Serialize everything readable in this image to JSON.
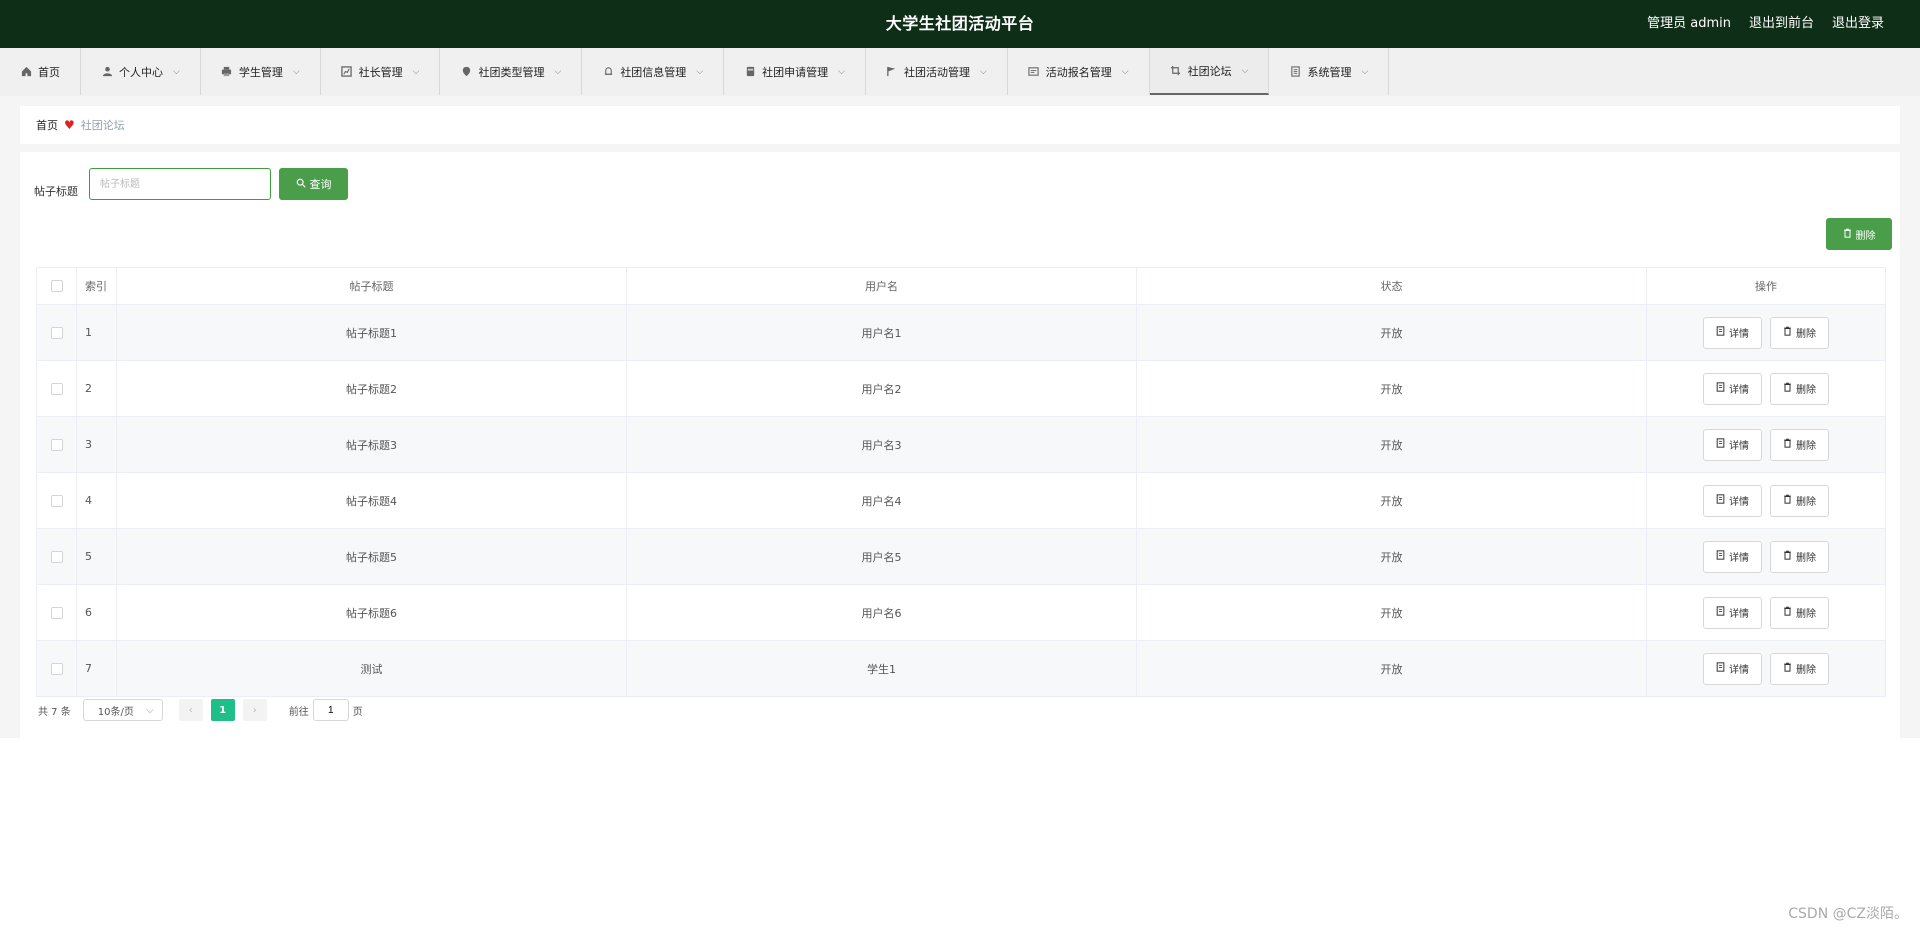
{
  "header": {
    "title": "大学生社团活动平台",
    "admin_label": "管理员 admin",
    "to_front_label": "退出到前台",
    "logout_label": "退出登录",
    "bg_color": "#0e2e18"
  },
  "nav": {
    "items": [
      {
        "label": "首页",
        "icon": "home-icon"
      },
      {
        "label": "个人中心",
        "icon": "user-icon"
      },
      {
        "label": "学生管理",
        "icon": "printer-icon"
      },
      {
        "label": "社长管理",
        "icon": "chart-icon"
      },
      {
        "label": "社团类型管理",
        "icon": "pin-icon"
      },
      {
        "label": "社团信息管理",
        "icon": "bell-icon"
      },
      {
        "label": "社团申请管理",
        "icon": "box-icon"
      },
      {
        "label": "社团活动管理",
        "icon": "flag-icon"
      },
      {
        "label": "活动报名管理",
        "icon": "card-icon"
      },
      {
        "label": "社团论坛",
        "icon": "crop-icon"
      },
      {
        "label": "系统管理",
        "icon": "list-icon"
      }
    ],
    "active_index": 9
  },
  "breadcrumb": {
    "home": "首页",
    "current": "社团论坛"
  },
  "search": {
    "label": "帖子标题",
    "placeholder": "帖子标题",
    "value": "",
    "query_label": "查询"
  },
  "toolbar": {
    "delete_label": "删除",
    "accent": "#4a9e4a"
  },
  "table": {
    "headers": {
      "index": "索引",
      "title": "帖子标题",
      "user": "用户名",
      "status": "状态",
      "ops": "操作"
    },
    "rows": [
      {
        "index": "1",
        "title": "帖子标题1",
        "user": "用户名1",
        "status": "开放",
        "detail": "详情",
        "delete": "删除"
      },
      {
        "index": "2",
        "title": "帖子标题2",
        "user": "用户名2",
        "status": "开放",
        "detail": "详情",
        "delete": "删除"
      },
      {
        "index": "3",
        "title": "帖子标题3",
        "user": "用户名3",
        "status": "开放",
        "detail": "详情",
        "delete": "删除"
      },
      {
        "index": "4",
        "title": "帖子标题4",
        "user": "用户名4",
        "status": "开放",
        "detail": "详情",
        "delete": "删除"
      },
      {
        "index": "5",
        "title": "帖子标题5",
        "user": "用户名5",
        "status": "开放",
        "detail": "详情",
        "delete": "删除"
      },
      {
        "index": "6",
        "title": "帖子标题6",
        "user": "用户名6",
        "status": "开放",
        "detail": "详情",
        "delete": "删除"
      },
      {
        "index": "7",
        "title": "测试",
        "user": "学生1",
        "status": "开放",
        "detail": "详情",
        "delete": "删除"
      }
    ]
  },
  "pagination": {
    "total": "共 7 条",
    "page_size": "10条/页",
    "current_page": "1",
    "goto_label": "前往",
    "goto_value": "1",
    "page_suffix": "页",
    "active_color": "#1fbf8a"
  },
  "watermark": "CSDN @CZ淡陌。"
}
